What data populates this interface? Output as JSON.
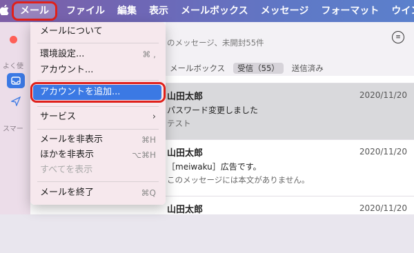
{
  "menubar": {
    "apple_icon": "apple-icon",
    "items": [
      "メール",
      "ファイル",
      "編集",
      "表示",
      "メールボックス",
      "メッセージ",
      "フォーマット",
      "ウイン"
    ]
  },
  "sidebar": {
    "label1": "よく使",
    "label2": "スマー",
    "icons": [
      "inbox-icon",
      "send-icon"
    ]
  },
  "list": {
    "subtitle": "のメッセージ、未開封55件",
    "tabs": [
      "メールボックス",
      "受信（55）",
      "送信済み"
    ],
    "messages": [
      {
        "from": "山田太郎",
        "date": "2020/11/20",
        "subject": "パスワード変更しました",
        "preview": "テスト"
      },
      {
        "from": "山田太郎",
        "date": "2020/11/20",
        "subject": "［meiwaku］広告です。",
        "preview": "このメッセージには本文がありません。"
      },
      {
        "from": "山田太郎",
        "date": "2020/11/20",
        "subject": "",
        "preview": ""
      }
    ]
  },
  "dropdown": {
    "about": "メールについて",
    "prefs": "環境設定...",
    "prefs_shortcut": "⌘ ,",
    "accounts": "アカウント...",
    "add_account": "アカウントを追加...",
    "services": "サービス",
    "hide_mail": "メールを非表示",
    "hide_mail_shortcut": "⌘H",
    "hide_others": "ほかを非表示",
    "hide_others_shortcut": "⌥⌘H",
    "show_all": "すべてを表示",
    "quit": "メールを終了",
    "quit_shortcut": "⌘Q"
  },
  "colors": {
    "accent": "#3b79e4",
    "highlight_outline": "#e0201a"
  }
}
